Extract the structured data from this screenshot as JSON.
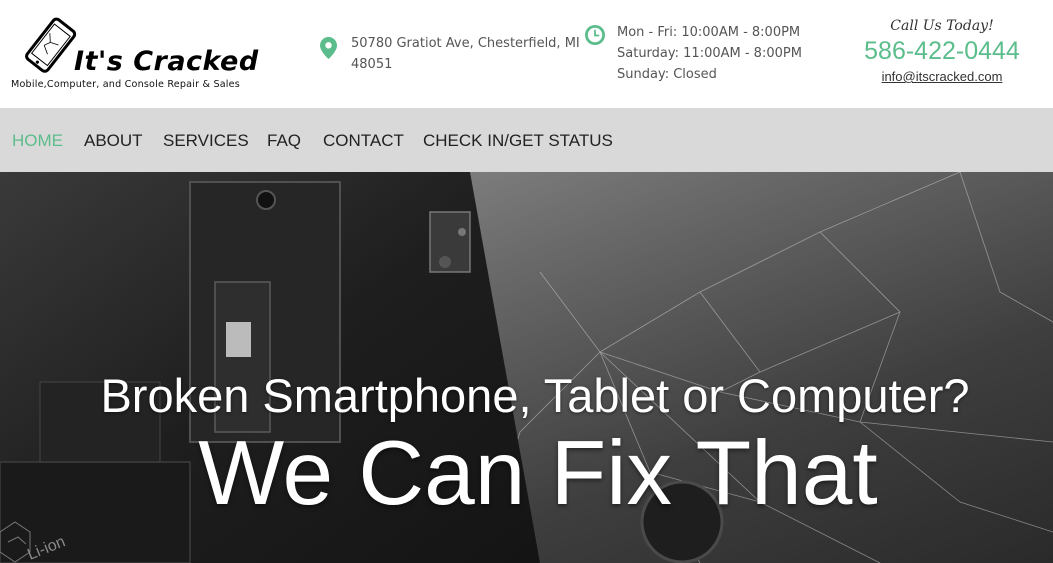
{
  "logo": {
    "title": "It's Cracked",
    "tagline": "Mobile,Computer, and Console Repair & Sales"
  },
  "address": {
    "line1": "50780 Gratiot Ave, Chesterfield, MI",
    "line2": "48051"
  },
  "hours": {
    "weekday": "Mon - Fri: 10:00AM - 8:00PM",
    "saturday": "Saturday: 11:00AM - 8:00PM",
    "sunday": "Sunday: Closed"
  },
  "contact": {
    "call_label": "Call Us Today!",
    "phone": "586-422-0444",
    "email": "info@itscracked.com"
  },
  "nav": {
    "items": [
      {
        "label": "HOME",
        "active": true
      },
      {
        "label": "ABOUT"
      },
      {
        "label": "SERVICES"
      },
      {
        "label": "FAQ"
      },
      {
        "label": "CONTACT"
      },
      {
        "label": "CHECK IN/GET STATUS"
      }
    ]
  },
  "hero": {
    "title": "Broken Smartphone, Tablet or Computer?",
    "subtitle": "We Can Fix That",
    "battery_print": "Li-ion"
  },
  "colors": {
    "accent": "#5bbd8b",
    "nav_bg": "#d9d9d9"
  }
}
